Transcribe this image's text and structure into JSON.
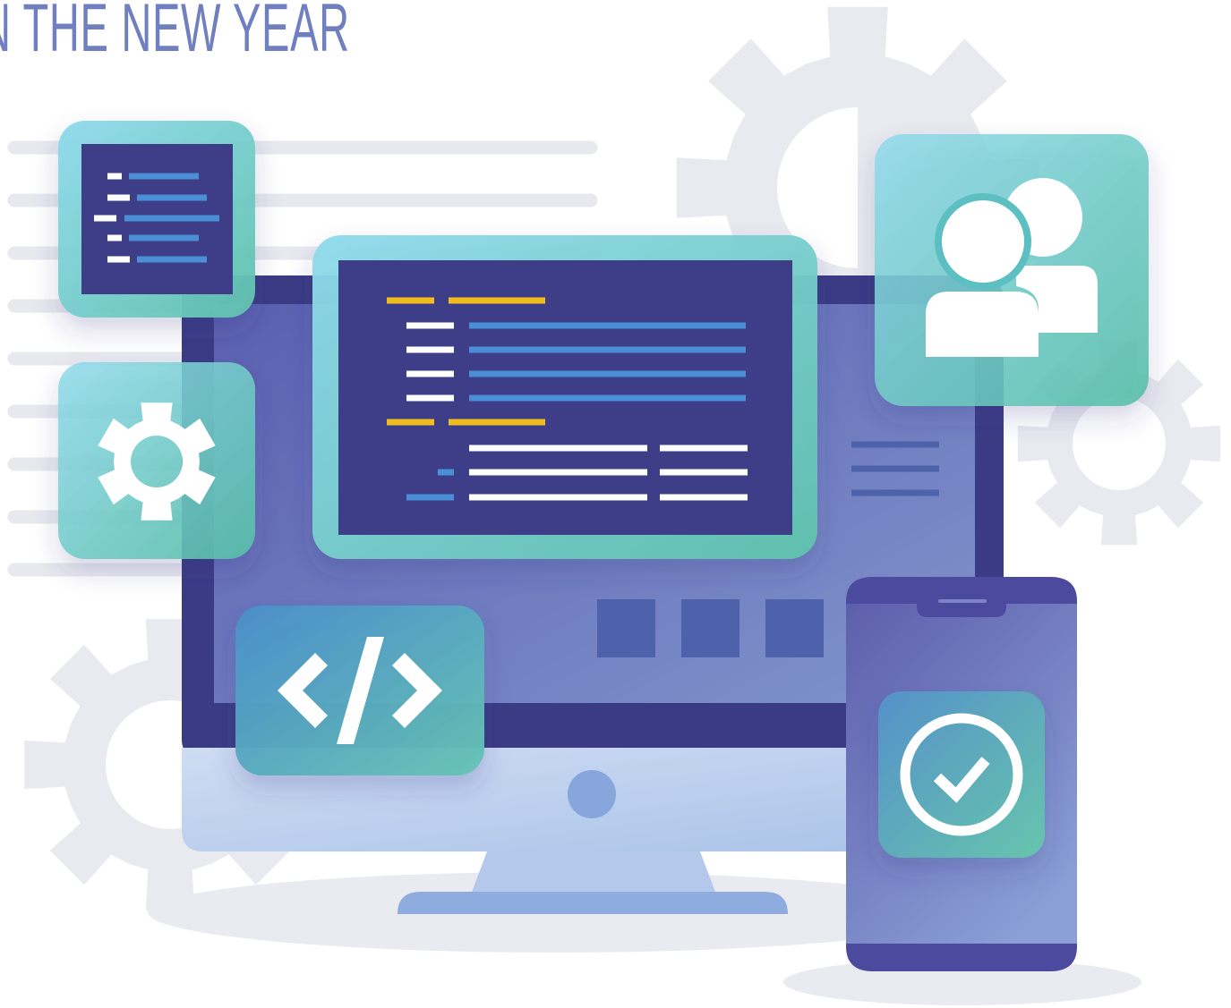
{
  "headline": {
    "text": "N THE NEW YEAR",
    "color": "#6f7fbf"
  },
  "colors": {
    "monitor_frame": "#3b3b85",
    "monitor_screen": "#6670b6",
    "monitor_stand": "#b4c8ec",
    "panel_teal": "#5bbfcc",
    "panel_green": "#66c4b0",
    "code_panel": "#3d3d88",
    "code_yellow": "#f2be1e",
    "code_blue": "#4a8fd6",
    "code_white": "#ffffff",
    "background_gear": "#e9e9f0",
    "phone_body": "#6e78bf"
  },
  "icons": [
    "code-listing-icon",
    "gear-icon",
    "code-brackets-icon",
    "users-icon",
    "check-circle-icon",
    "background-gear-icon"
  ]
}
